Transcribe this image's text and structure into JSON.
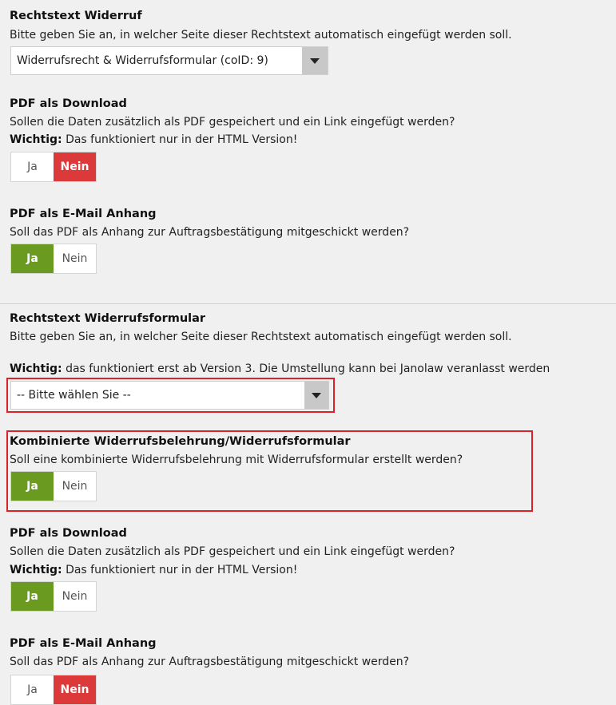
{
  "sections": [
    {
      "title": "Rechtstext Widerruf",
      "desc": "Bitte geben Sie an, in welcher Seite dieser Rechtstext automatisch eingefügt werden soll.",
      "select_value": "Widerrufsrecht & Widerrufsformular (coID: 9)"
    },
    {
      "title": "PDF als Download",
      "desc": "Sollen die Daten zusätzlich als PDF gespeichert und ein Link eingefügt werden?",
      "note_label": "Wichtig:",
      "note_text": " Das funktioniert nur in der HTML Version!",
      "yes": "Ja",
      "no": "Nein",
      "selected": "Nein"
    },
    {
      "title": "PDF als E-Mail Anhang",
      "desc": "Soll das PDF als Anhang zur Auftragsbestätigung mitgeschickt werden?",
      "yes": "Ja",
      "no": "Nein",
      "selected": "Ja"
    },
    {
      "title": "Rechtstext Widerrufsformular",
      "desc": "Bitte geben Sie an, in welcher Seite dieser Rechtstext automatisch eingefügt werden soll.",
      "note_label": "Wichtig:",
      "note_text": " das funktioniert erst ab Version 3. Die Umstellung kann bei Janolaw veranlasst werden",
      "select_value": "-- Bitte wählen Sie --"
    },
    {
      "title": "Kombinierte Widerrufsbelehrung/Widerrufsformular",
      "desc": "Soll eine kombinierte Widerrufsbelehrung mit Widerrufsformular erstellt werden?",
      "yes": "Ja",
      "no": "Nein",
      "selected": "Ja"
    },
    {
      "title": "PDF als Download",
      "desc": "Sollen die Daten zusätzlich als PDF gespeichert und ein Link eingefügt werden?",
      "note_label": "Wichtig:",
      "note_text": " Das funktioniert nur in der HTML Version!",
      "yes": "Ja",
      "no": "Nein",
      "selected": "Ja"
    },
    {
      "title": "PDF als E-Mail Anhang",
      "desc": "Soll das PDF als Anhang zur Auftragsbestätigung mitgeschickt werden?",
      "yes": "Ja",
      "no": "Nein",
      "selected": "Nein"
    }
  ],
  "colors": {
    "yes_active": "#6a9a1f",
    "no_active": "#dc3a3a",
    "highlight": "#d8232a"
  },
  "icons": {
    "dropdown": "chevron-down-icon"
  }
}
